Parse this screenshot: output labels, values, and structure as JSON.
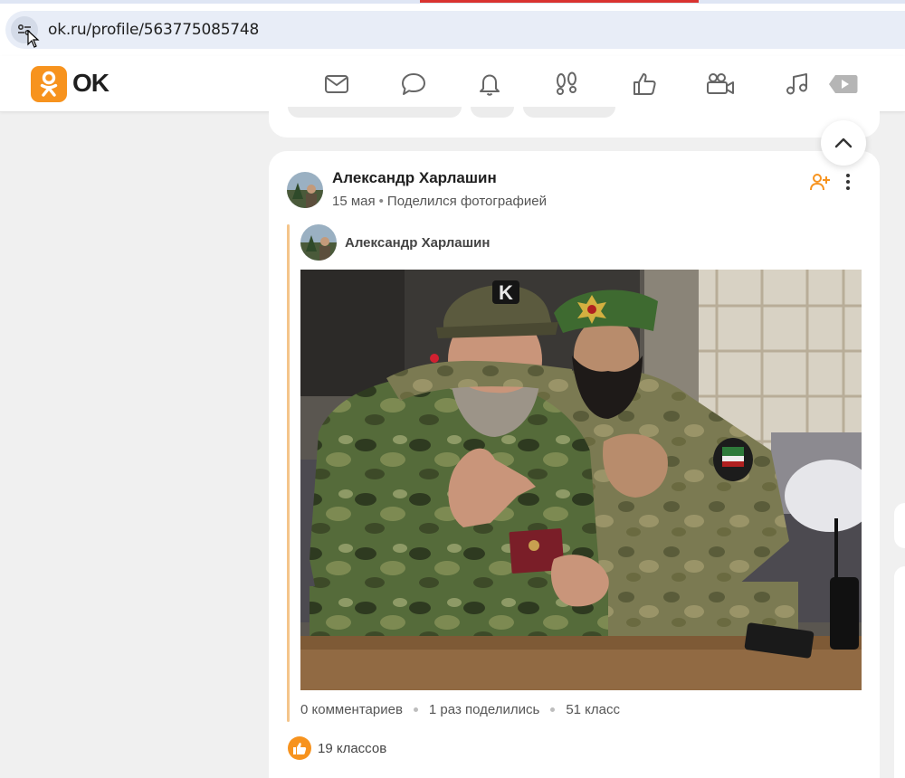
{
  "browser": {
    "url": "ok.ru/profile/563775085748"
  },
  "header": {
    "logo_text": "OK",
    "nav_icons": [
      "mail-icon",
      "chat-icon",
      "bell-icon",
      "footprints-icon",
      "like-icon",
      "video-camera-icon",
      "music-icon",
      "video-play-icon"
    ],
    "accent_color": "#f7931e"
  },
  "post": {
    "author": "Александр Харлашин",
    "date": "15 мая",
    "action": "Поделился фотографией",
    "inner_author": "Александр Харлашин",
    "stats": {
      "comments": "0 комментариев",
      "shares": "1 раз поделились",
      "classes": "51 класс"
    },
    "likes": "19 классов"
  }
}
